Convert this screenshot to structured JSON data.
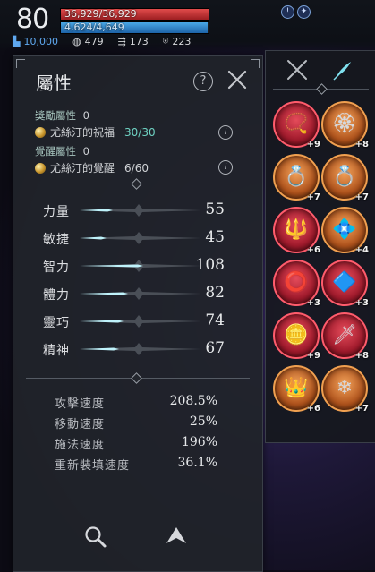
{
  "hud": {
    "level": "80",
    "hp_text": "36,929/36,929",
    "hp_fraction": 1.0,
    "mp_text": "4,624/4,649",
    "mp_fraction": 0.995,
    "status_icons": [
      "alert-status-icon",
      "buff-status-icon"
    ],
    "currency": [
      {
        "icon": "chest-icon",
        "value": "10,000",
        "color": "#5fa8f0"
      },
      {
        "icon": "coin-icon",
        "value": "479"
      },
      {
        "icon": "scroll-icon",
        "value": "173"
      },
      {
        "icon": "wings-icon",
        "value": "223"
      }
    ]
  },
  "panel": {
    "title": "屬性",
    "bonus_label": "獎勵屬性",
    "bonus_value": "0",
    "bonus_sub_label": "尤絲汀的祝福",
    "bonus_sub_value": "30/30",
    "awaken_label": "覺醒屬性",
    "awaken_value": "0",
    "awaken_sub_label": "尤絲汀的覺醒",
    "awaken_sub_value": "6/60"
  },
  "stats": [
    {
      "label": "力量",
      "value": "55",
      "fill": 0.26
    },
    {
      "label": "敏捷",
      "value": "45",
      "fill": 0.21
    },
    {
      "label": "智力",
      "value": "108",
      "fill": 0.5
    },
    {
      "label": "體力",
      "value": "82",
      "fill": 0.38
    },
    {
      "label": "靈巧",
      "value": "74",
      "fill": 0.34
    },
    {
      "label": "精神",
      "value": "67",
      "fill": 0.31
    }
  ],
  "speeds": [
    {
      "label": "攻擊速度",
      "value": "208.5%"
    },
    {
      "label": "移動速度",
      "value": "25%"
    },
    {
      "label": "施法速度",
      "value": "196%"
    },
    {
      "label": "重新裝填速度",
      "value": "36.1%"
    }
  ],
  "inventory": {
    "tabs": [
      "crossed-swords-icon",
      "quill-icon"
    ],
    "items": [
      {
        "icon": "amulet-icon",
        "glyph": "📿",
        "plus": "+9",
        "rarity": "red"
      },
      {
        "icon": "necklace-icon",
        "glyph": "🏵",
        "plus": "+8",
        "rarity": "orange"
      },
      {
        "icon": "ring-icon",
        "glyph": "💍",
        "plus": "+7",
        "rarity": "orange"
      },
      {
        "icon": "ring-icon",
        "glyph": "💍",
        "plus": "+7",
        "rarity": "orange"
      },
      {
        "icon": "pendant-icon",
        "glyph": "🔱",
        "plus": "+6",
        "rarity": "red"
      },
      {
        "icon": "gem-icon",
        "glyph": "💠",
        "plus": "+4",
        "rarity": "orange"
      },
      {
        "icon": "ring-icon",
        "glyph": "⭕",
        "plus": "+3",
        "rarity": "red"
      },
      {
        "icon": "crystal-icon",
        "glyph": "🔷",
        "plus": "+3",
        "rarity": "red"
      },
      {
        "icon": "medallion-icon",
        "glyph": "🪙",
        "plus": "+9",
        "rarity": "red"
      },
      {
        "icon": "dagger-icon",
        "glyph": "🗡",
        "plus": "+8",
        "rarity": "red"
      },
      {
        "icon": "crown-icon",
        "glyph": "👑",
        "plus": "+6",
        "rarity": "orange"
      },
      {
        "icon": "ice-crystal-icon",
        "glyph": "❄",
        "plus": "+7",
        "rarity": "orange"
      }
    ]
  },
  "colors": {
    "accent": "#7fe0ee",
    "hp": "#d63a3f",
    "mp": "#3e94d8",
    "rare": "#f0a050",
    "epic": "#ff5c6c"
  }
}
